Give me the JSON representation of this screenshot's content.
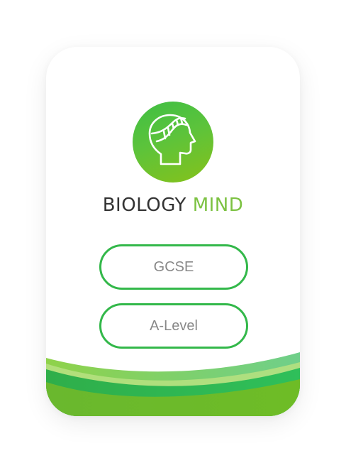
{
  "app": {
    "brand_primary": "BIOLOGY",
    "brand_accent": "MIND",
    "logo_icon": "head-dna-icon"
  },
  "levels": {
    "gcse_label": "GCSE",
    "alevel_label": "A-Level"
  },
  "colors": {
    "accent_green": "#7cc242",
    "button_border": "#33b84a",
    "wave_green": "#3bbf4a",
    "text_dark": "#333333",
    "text_gray": "#888888"
  }
}
